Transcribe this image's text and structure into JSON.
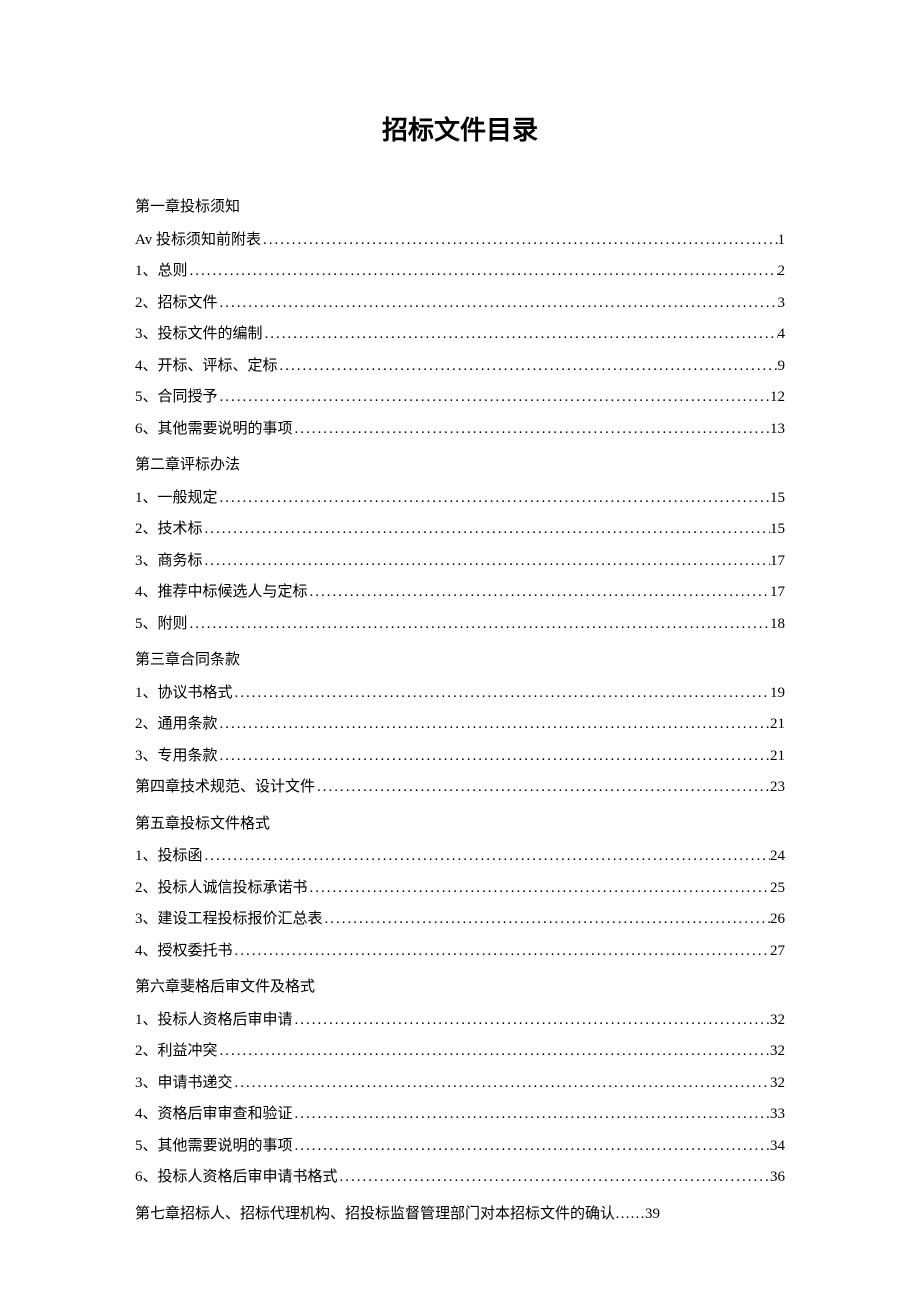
{
  "title": "招标文件目录",
  "entries": [
    {
      "type": "heading",
      "label": "第一章投标须知"
    },
    {
      "type": "item",
      "label": "Av 投标须知前附表",
      "page": "1"
    },
    {
      "type": "item",
      "label": "1、总则",
      "page": "2"
    },
    {
      "type": "item",
      "label": "2、招标文件",
      "page": "3"
    },
    {
      "type": "item",
      "label": "3、投标文件的编制",
      "page": "4"
    },
    {
      "type": "item",
      "label": "4、开标、评标、定标",
      "page": "9"
    },
    {
      "type": "item",
      "label": "5、合同授予",
      "page": "12"
    },
    {
      "type": "item",
      "label": "6、其他需要说明的事项",
      "page": "13"
    },
    {
      "type": "heading",
      "label": "第二章评标办法"
    },
    {
      "type": "item",
      "label": "1、一般规定",
      "page": "15"
    },
    {
      "type": "item",
      "label": "2、技术标",
      "page": "15"
    },
    {
      "type": "item",
      "label": "3、商务标",
      "page": "17"
    },
    {
      "type": "item",
      "label": "4、推荐中标候选人与定标",
      "page": "17"
    },
    {
      "type": "item",
      "label": "5、附则",
      "page": "18"
    },
    {
      "type": "heading",
      "label": "第三章合同条款"
    },
    {
      "type": "item",
      "label": "1、协议书格式",
      "page": "19"
    },
    {
      "type": "item",
      "label": "2、通用条款",
      "page": "21"
    },
    {
      "type": "item",
      "label": "3、专用条款",
      "page": "21"
    },
    {
      "type": "item",
      "label": "第四章技术规范、设计文件",
      "page": "23"
    },
    {
      "type": "heading",
      "label": "第五章投标文件格式"
    },
    {
      "type": "item",
      "label": "1、投标函",
      "page": "24"
    },
    {
      "type": "item",
      "label": "2、投标人诚信投标承诺书",
      "page": "25"
    },
    {
      "type": "item",
      "label": "3、建设工程投标报价汇总表",
      "page": "26"
    },
    {
      "type": "item",
      "label": "4、授权委托书",
      "page": "27"
    },
    {
      "type": "heading",
      "label": "第六章斐格后审文件及格式"
    },
    {
      "type": "item",
      "label": "1、投标人资格后审申请",
      "page": "32"
    },
    {
      "type": "item",
      "label": "2、利益冲突",
      "page": "32"
    },
    {
      "type": "item",
      "label": "3、申请书递交",
      "page": "32"
    },
    {
      "type": "item",
      "label": "4、资格后审审查和验证",
      "page": "33"
    },
    {
      "type": "item",
      "label": "5、其他需要说明的事项",
      "page": "34"
    },
    {
      "type": "item",
      "label": "6、投标人资格后审申请书格式",
      "page": "36"
    },
    {
      "type": "heading",
      "label": "第七章招标人、招标代理机构、招投标监督管理部门对本招标文件的确认……39"
    }
  ]
}
